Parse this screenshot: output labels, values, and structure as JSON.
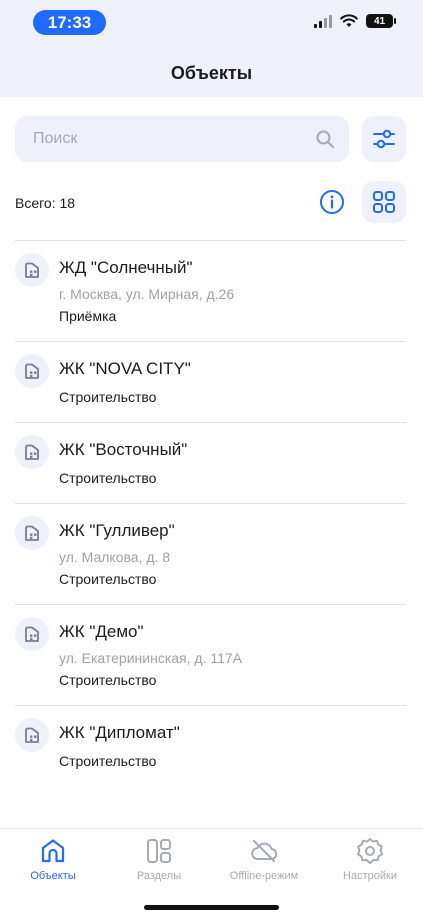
{
  "status_bar": {
    "time": "17:33",
    "battery": "41"
  },
  "header": {
    "title": "Объекты"
  },
  "search": {
    "placeholder": "Поиск",
    "value": ""
  },
  "summary": {
    "total_label": "Всего: 18"
  },
  "objects": [
    {
      "title": "ЖД \"Солнечный\"",
      "address": "г. Москва, ул. Мирная, д.26",
      "status": "Приёмка"
    },
    {
      "title": "ЖК \"NOVA CITY\"",
      "address": "",
      "status": "Строительство"
    },
    {
      "title": "ЖК \"Восточный\"",
      "address": "",
      "status": "Строительство"
    },
    {
      "title": "ЖК \"Гулливер\"",
      "address": "ул. Малкова, д. 8",
      "status": "Строительство"
    },
    {
      "title": "ЖК \"Демо\"",
      "address": "ул. Екатерининская, д. 117А",
      "status": "Строительство"
    },
    {
      "title": "ЖК \"Дипломат\"",
      "address": "",
      "status": "Строительство"
    }
  ],
  "tabbar": {
    "tabs": [
      {
        "label": "Объекты",
        "icon": "home-icon",
        "active": true
      },
      {
        "label": "Разделы",
        "icon": "sections-icon",
        "active": false
      },
      {
        "label": "Offline-режим",
        "icon": "cloud-off-icon",
        "active": false
      },
      {
        "label": "Настройки",
        "icon": "gear-icon",
        "active": false
      }
    ]
  },
  "colors": {
    "accent": "#1f6bff",
    "surface": "#eef1fa",
    "muted": "#a5aab7",
    "divider": "#dfe2e8"
  }
}
